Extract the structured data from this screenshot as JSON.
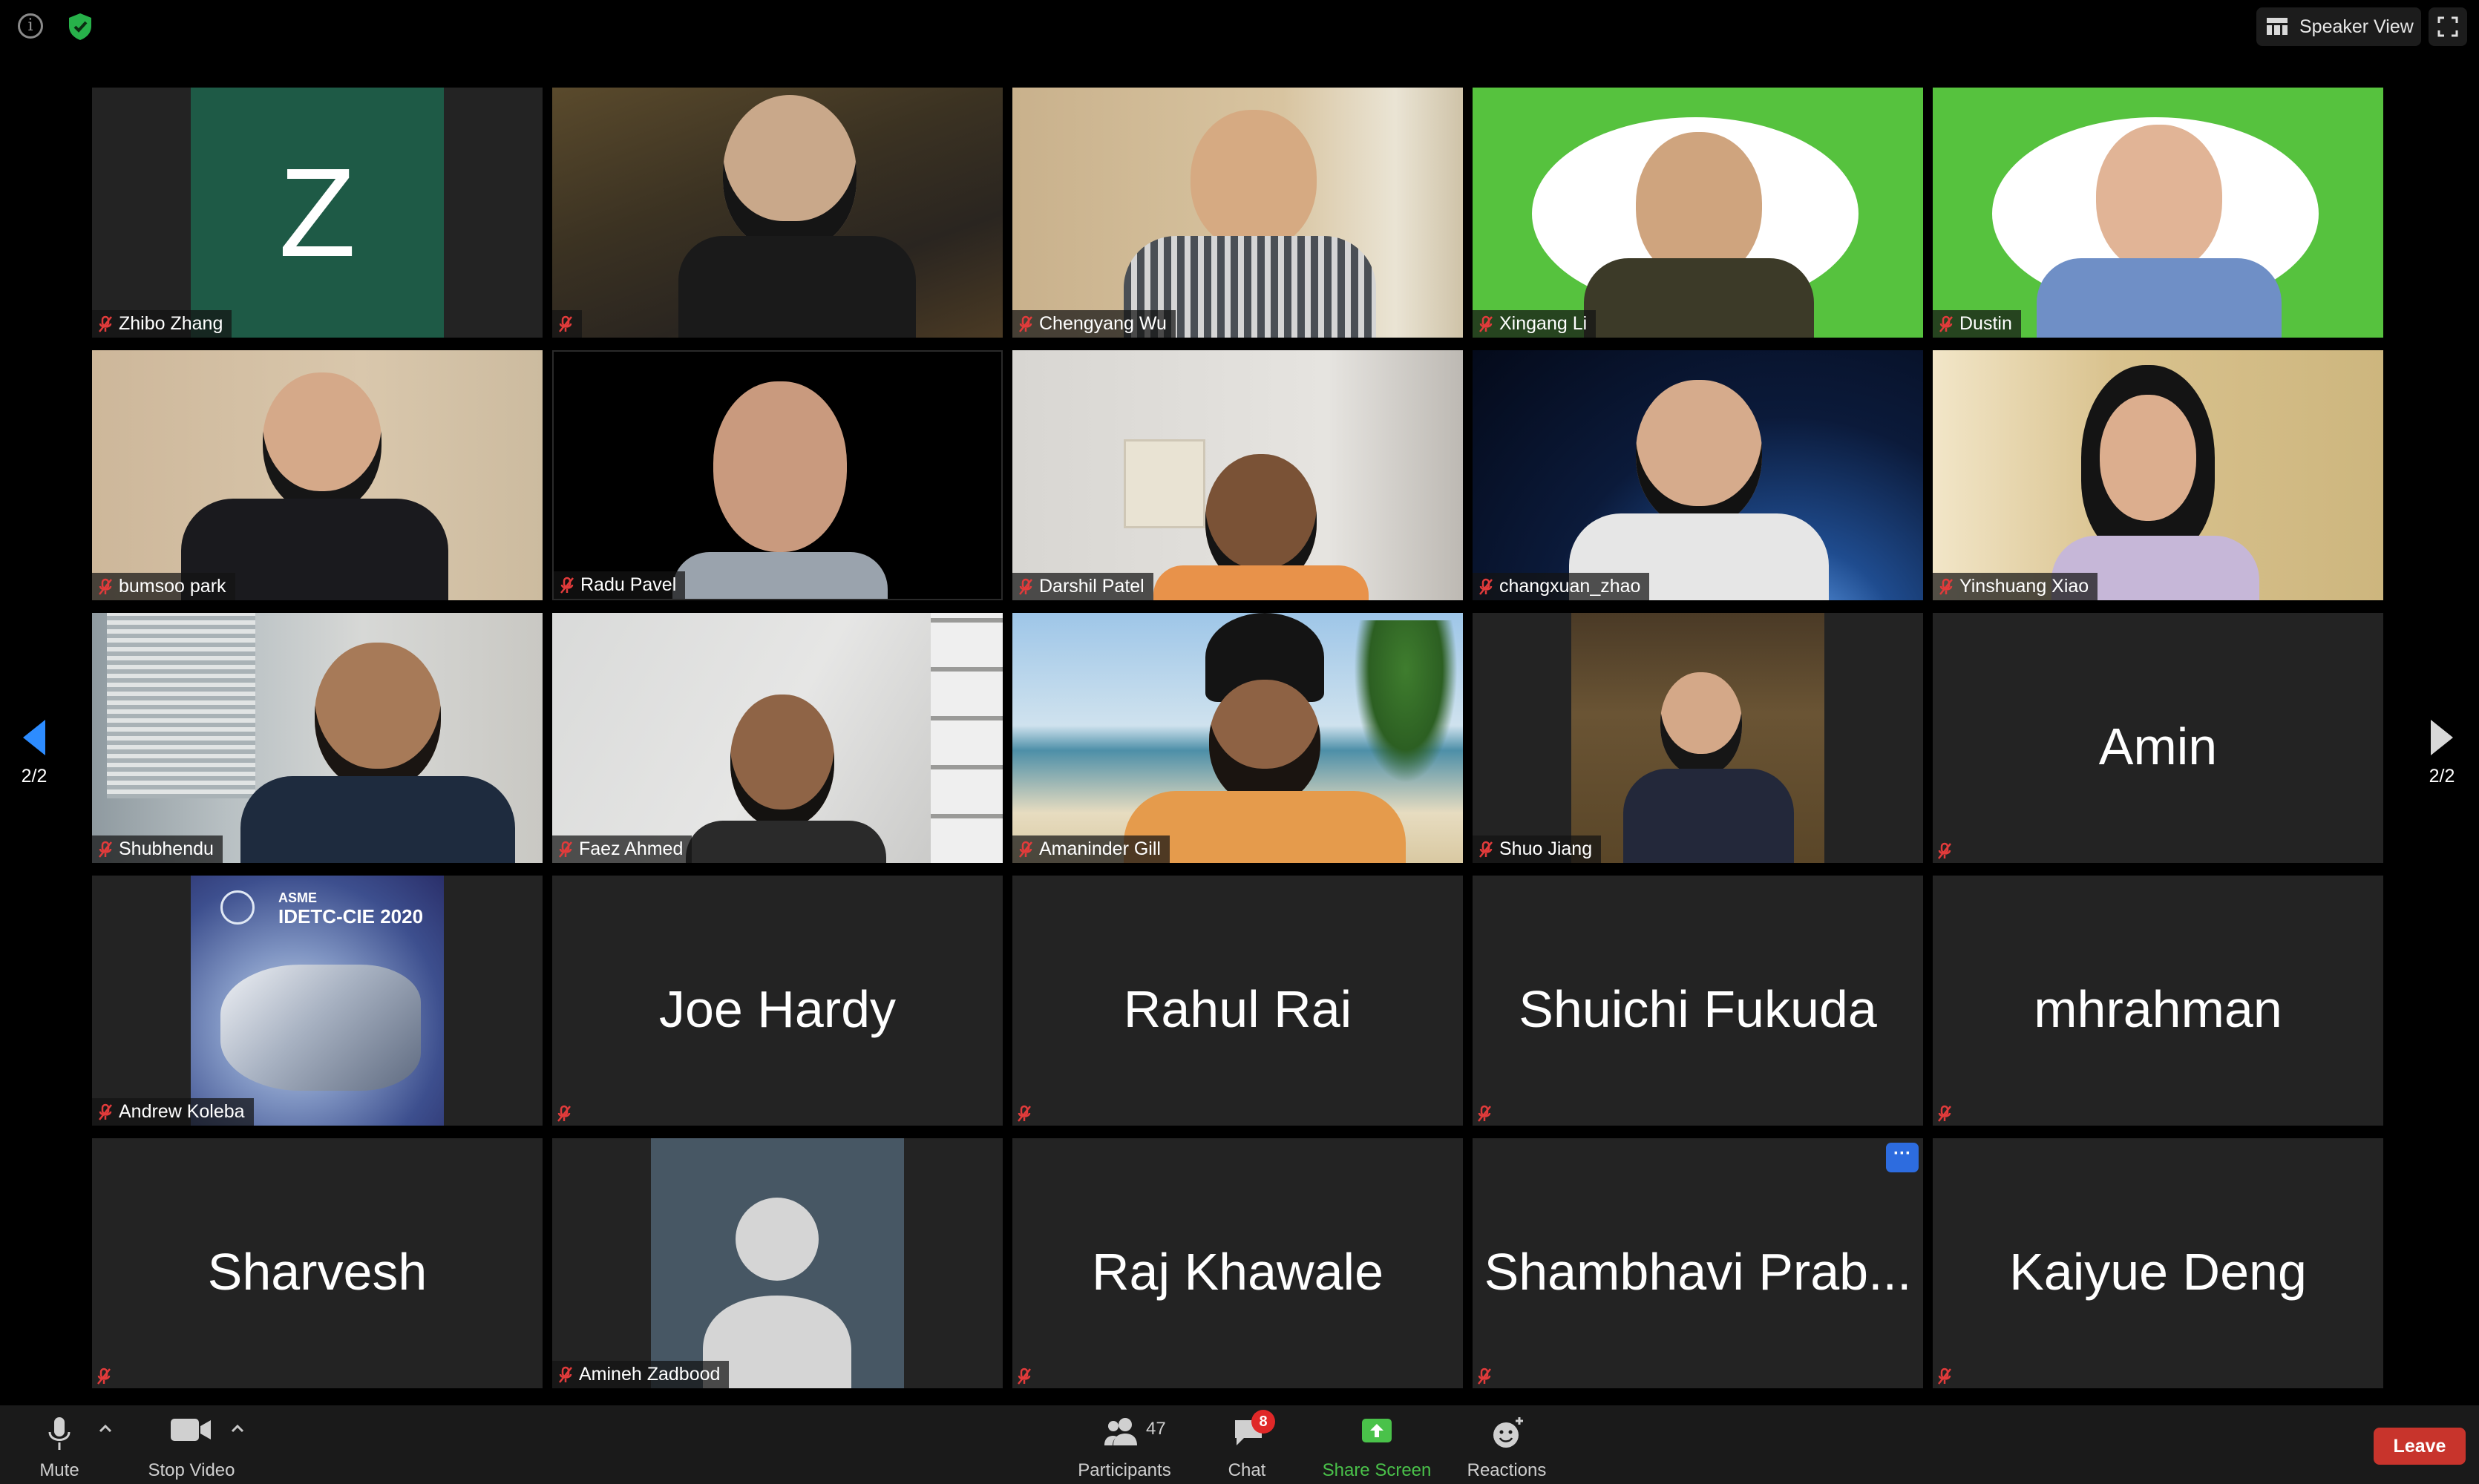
{
  "window": {
    "view_mode_label": "Speaker View",
    "page_indicator_left": "2/2",
    "page_indicator_right": "2/2"
  },
  "colors": {
    "muted_mic": "#e23b3b",
    "share_screen": "#4ac24a",
    "leave": "#c8342c",
    "chat_badge": "#e02828",
    "greenscreen": "#56c23e"
  },
  "participants": [
    {
      "name": "Zhibo Zhang",
      "display": "initial",
      "initial": "Z",
      "muted": true
    },
    {
      "name": "",
      "display": "video",
      "muted": true
    },
    {
      "name": "Chengyang Wu",
      "display": "video",
      "muted": true
    },
    {
      "name": "Xingang Li",
      "display": "video",
      "muted": true
    },
    {
      "name": "Dustin",
      "display": "video",
      "muted": true
    },
    {
      "name": "bumsoo park",
      "display": "video",
      "muted": true
    },
    {
      "name": "Radu Pavel",
      "display": "video",
      "muted": true
    },
    {
      "name": "Darshil Patel",
      "display": "video",
      "muted": true
    },
    {
      "name": "changxuan_zhao",
      "display": "video",
      "muted": true
    },
    {
      "name": "Yinshuang Xiao",
      "display": "video",
      "muted": true
    },
    {
      "name": "Shubhendu",
      "display": "video",
      "muted": true
    },
    {
      "name": "Faez Ahmed",
      "display": "video",
      "muted": true
    },
    {
      "name": "Amaninder Gill",
      "display": "video",
      "muted": true
    },
    {
      "name": "Shuo Jiang",
      "display": "video",
      "muted": true
    },
    {
      "name": "Amin",
      "display": "name",
      "muted": true
    },
    {
      "name": "Andrew Koleba",
      "display": "poster",
      "poster_brand": "ASME",
      "poster_title": "IDETC-CIE 2020",
      "muted": true
    },
    {
      "name": "Joe Hardy",
      "display": "name",
      "muted": true
    },
    {
      "name": "Rahul Rai",
      "display": "name",
      "muted": true
    },
    {
      "name": "Shuichi Fukuda",
      "display": "name",
      "muted": true
    },
    {
      "name": "mhrahman",
      "display": "name",
      "muted": true
    },
    {
      "name": "Sharvesh",
      "display": "name",
      "muted": true
    },
    {
      "name": "Amineh Zadbood",
      "display": "avatar",
      "muted": true
    },
    {
      "name": "Raj Khawale",
      "display": "name",
      "muted": true
    },
    {
      "name": "Shambhavi Prab...",
      "display": "name",
      "muted": true,
      "more_menu": true,
      "more_icon": "ellipsis-icon"
    },
    {
      "name": "Kaiyue Deng",
      "display": "name",
      "muted": true
    }
  ],
  "toolbar": {
    "mute_label": "Mute",
    "stop_video_label": "Stop Video",
    "participants_label": "Participants",
    "participants_count": "47",
    "chat_label": "Chat",
    "chat_badge": "8",
    "share_screen_label": "Share Screen",
    "reactions_label": "Reactions",
    "leave_label": "Leave"
  }
}
